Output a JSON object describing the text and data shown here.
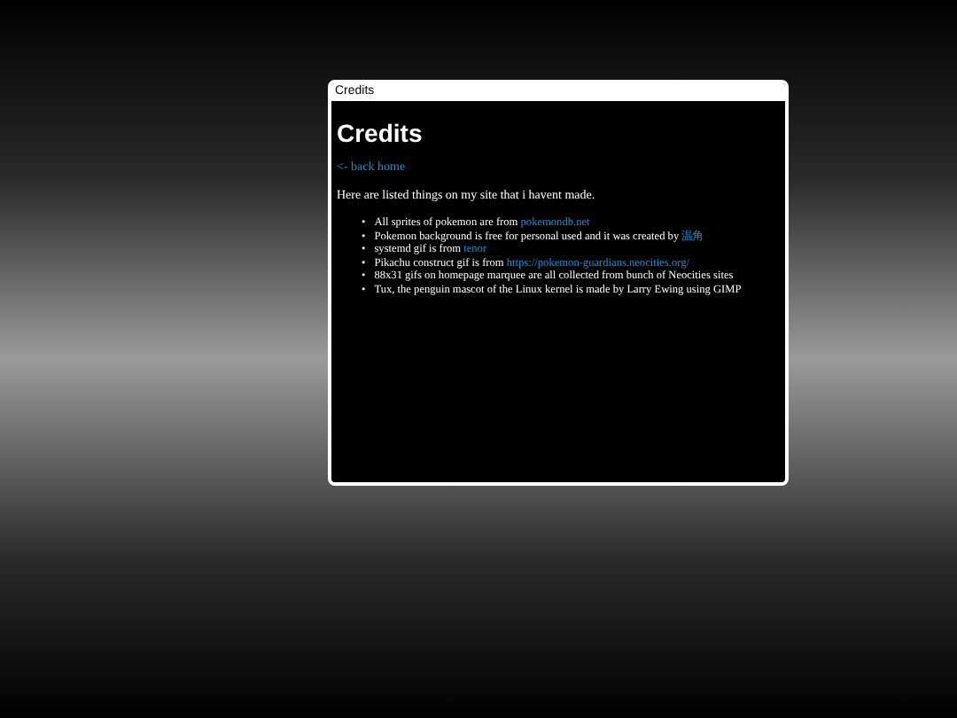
{
  "window": {
    "title": "Credits"
  },
  "heading": "Credits",
  "back_link": "<- back home",
  "intro": "Here are listed things on my site that i havent made.",
  "items": [
    {
      "bullet": "•",
      "text": "All sprites of pokemon are from ",
      "link": "pokemondb.net"
    },
    {
      "bullet": "•",
      "text": "Pokemon background is free for personal used and it was created by ",
      "link": "温角"
    },
    {
      "bullet": "•",
      "text": "systemd gif is from ",
      "link": "tenor"
    },
    {
      "bullet": "•",
      "text": "Pikachu construct gif is from ",
      "link": "https://pokemon-guardians.neocities.org/"
    },
    {
      "bullet": "•",
      "text": "88x31 gifs on homepage marquee are all collected from bunch of Neocities sites"
    },
    {
      "bullet": "•",
      "text": "Tux, the penguin mascot of the Linux kernel is made by Larry Ewing using GIMP"
    }
  ]
}
